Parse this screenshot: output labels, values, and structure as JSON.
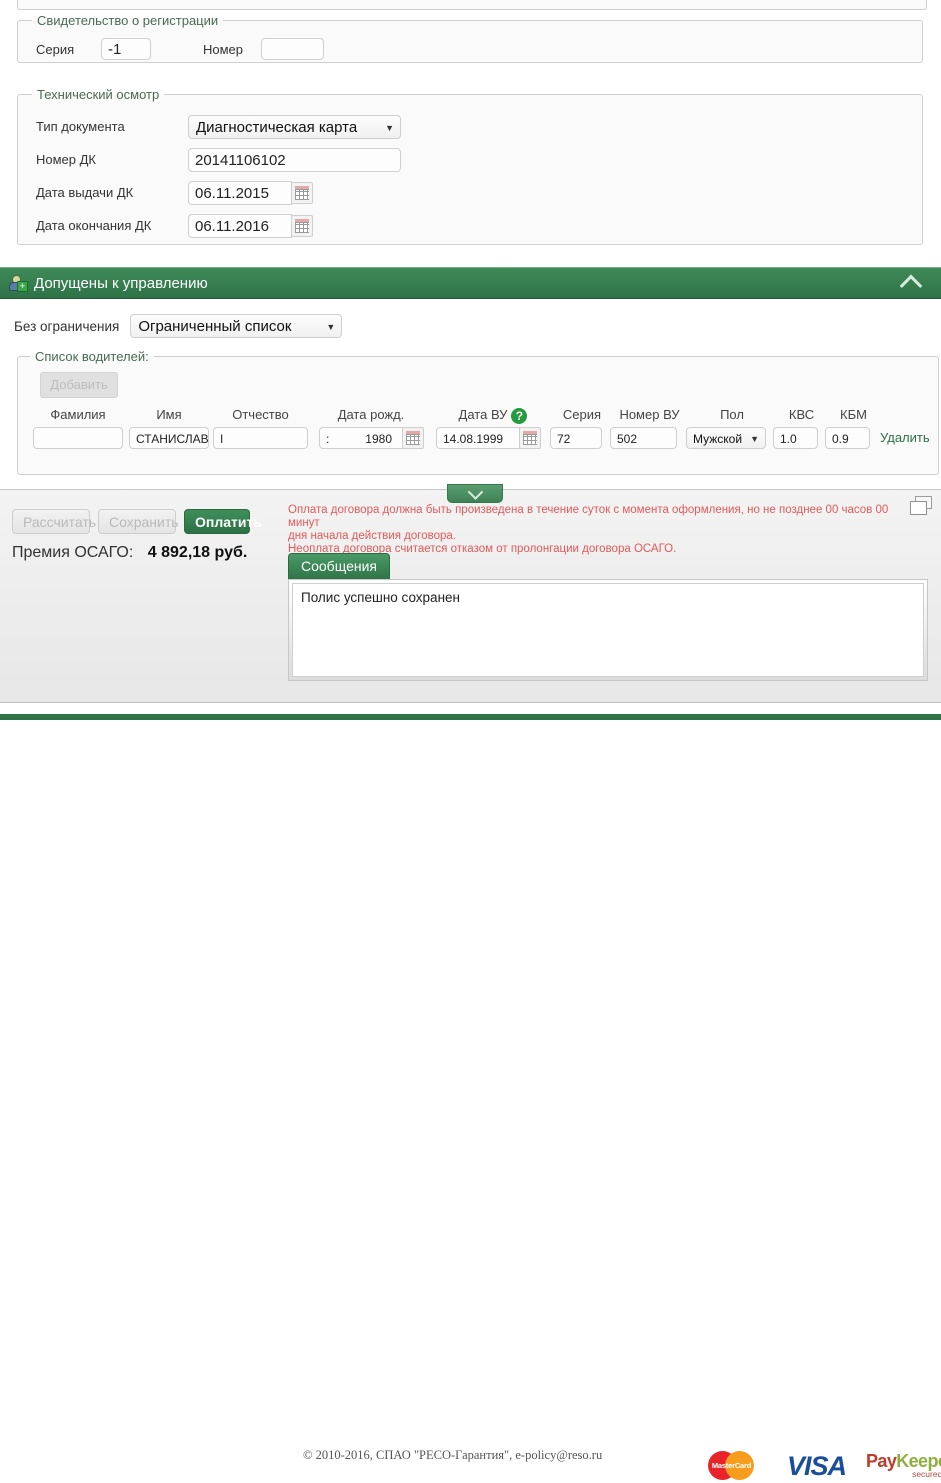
{
  "registration": {
    "legend": "Свидетельство о регистрации",
    "series_label": "Серия",
    "series_value": "-1",
    "number_label": "Номер",
    "number_value": ""
  },
  "inspection": {
    "legend": "Технический осмотр",
    "doc_type_label": "Тип документа",
    "doc_type_value": "Диагностическая карта",
    "dk_number_label": "Номер ДК",
    "dk_number_value": "20141106102",
    "dk_issue_label": "Дата выдачи ДК",
    "dk_issue_value": "06.11.2015",
    "dk_end_label": "Дата окончания ДК",
    "dk_end_value": "06.11.2016"
  },
  "drivers_section": {
    "title": "Допущены к управлению",
    "restriction_label": "Без ограничения",
    "restriction_value": "Ограниченный список",
    "list_legend": "Список водителей:",
    "add_button": "Добавить",
    "columns": [
      "Фамилия",
      "Имя",
      "Отчество",
      "Дата рожд.",
      "Дата ВУ",
      "Серия",
      "Номер ВУ",
      "Пол",
      "КВС",
      "КБМ"
    ],
    "rows": [
      {
        "surname": "",
        "name": "СТАНИСЛАВ",
        "patronymic": "I",
        "birth_prefix": ":",
        "birth_date": "1980",
        "licence_date": "14.08.1999",
        "series": "72",
        "number": "502",
        "gender": "Мужской",
        "kvs": "1.0",
        "kbm": "0.9",
        "delete_label": "Удалить"
      }
    ]
  },
  "payment": {
    "calculate_button": "Рассчитать",
    "save_button": "Сохранить",
    "pay_button": "Оплатить",
    "premium_label": "Премия ОСАГО:",
    "premium_value": "4 892,18 руб.",
    "warning_line1": "Оплата договора должна быть произведена в течение суток с момента оформления, но не позднее 00 часов 00 минут",
    "warning_line2": "дня начала действия договора.",
    "warning_line3": "Неоплата договора считается отказом от пролонгации договора ОСАГО.",
    "messages_tab": "Сообщения",
    "messages_text": "Полис успешно сохранен"
  },
  "footer": {
    "copyright": "© 2010-2016, СПАО \"РЕСО-Гарантия\", e-policy@reso.ru",
    "mastercard_label": "MasterCard",
    "visa_label": "VISA",
    "paykeeper_pay": "Pay",
    "paykeeper_keeper": "Keeper",
    "paykeeper_secured": "secured by"
  },
  "colors": {
    "brand_green": "#2f7347",
    "warning_red": "#e05a5a",
    "visa_blue": "#1a4d9c"
  }
}
